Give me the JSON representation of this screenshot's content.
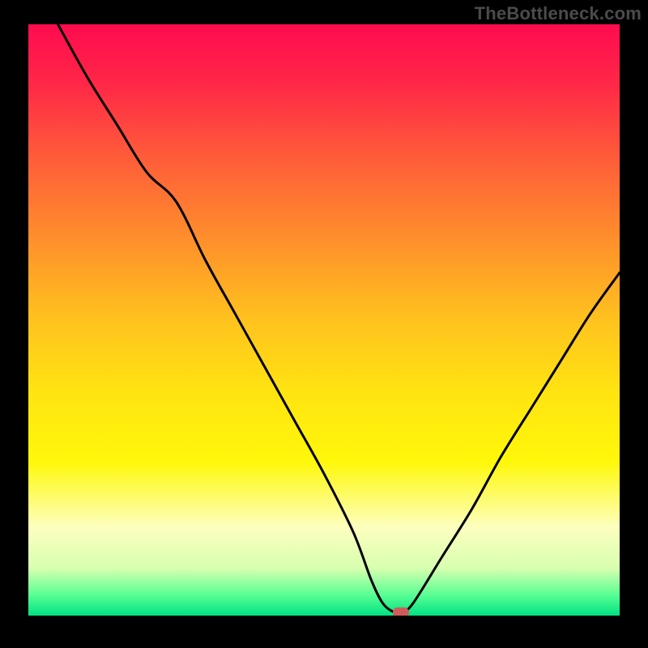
{
  "watermark": "TheBottleneck.com",
  "chart_data": {
    "type": "line",
    "title": "",
    "xlabel": "",
    "ylabel": "",
    "xlim": [
      0,
      100
    ],
    "ylim": [
      0,
      100
    ],
    "grid": false,
    "legend": false,
    "series": [
      {
        "name": "curve",
        "x": [
          5,
          10,
          15,
          20,
          25,
          30,
          35,
          40,
          45,
          50,
          55,
          58,
          60,
          62,
          63,
          65,
          70,
          75,
          80,
          85,
          90,
          95,
          100
        ],
        "values": [
          100,
          91,
          83,
          75,
          70,
          60,
          51,
          42,
          33,
          24,
          14,
          6,
          2,
          0.5,
          0.5,
          2,
          10,
          18,
          27,
          35,
          43,
          51,
          58
        ]
      }
    ],
    "marker": {
      "x": 63,
      "y": 0.5
    },
    "background": {
      "type": "vertical-gradient",
      "stops": [
        {
          "pos": 0.0,
          "color": "#ff0b4f"
        },
        {
          "pos": 0.1,
          "color": "#ff2747"
        },
        {
          "pos": 0.22,
          "color": "#ff5a3a"
        },
        {
          "pos": 0.35,
          "color": "#ff8a2d"
        },
        {
          "pos": 0.5,
          "color": "#ffc21e"
        },
        {
          "pos": 0.62,
          "color": "#ffe311"
        },
        {
          "pos": 0.74,
          "color": "#fff80a"
        },
        {
          "pos": 0.85,
          "color": "#fdffbe"
        },
        {
          "pos": 0.92,
          "color": "#d7ffb0"
        },
        {
          "pos": 0.965,
          "color": "#59ff93"
        },
        {
          "pos": 1.0,
          "color": "#00e183"
        }
      ]
    }
  }
}
